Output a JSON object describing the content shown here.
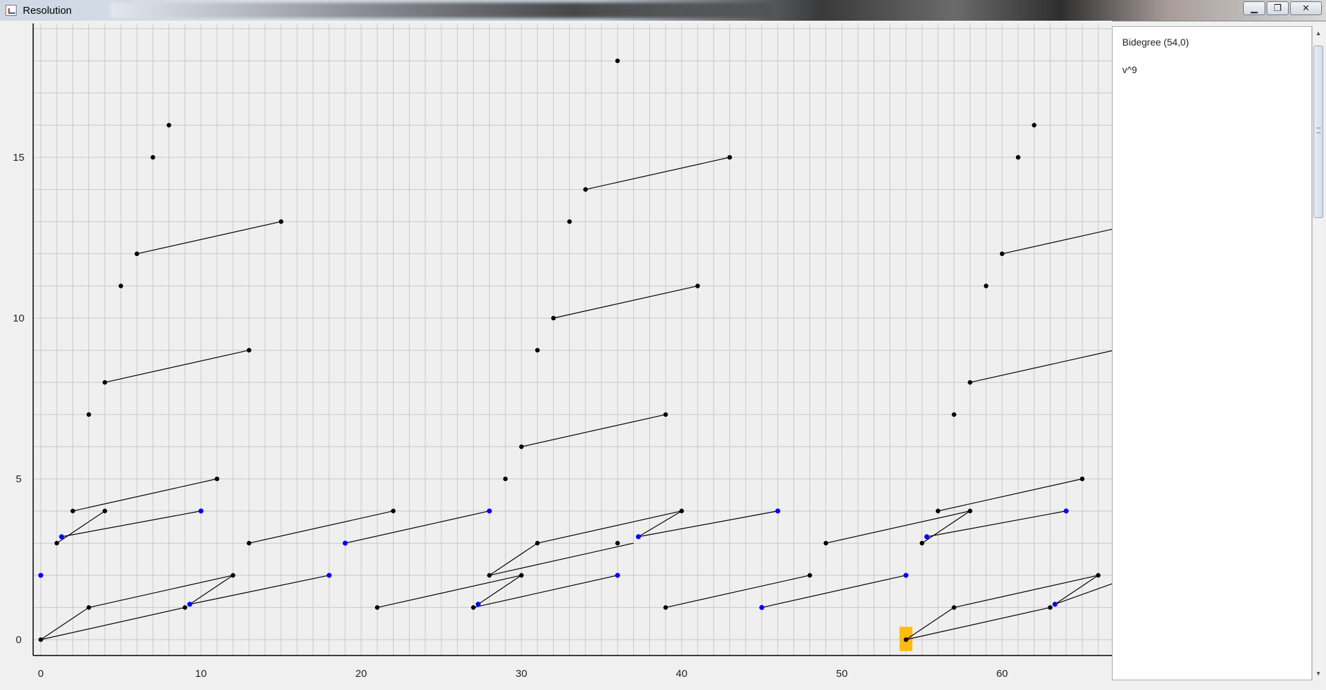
{
  "window": {
    "title": "Resolution",
    "minimize": "▁",
    "maximize": "❐",
    "close": "✕"
  },
  "info": {
    "line1": "Bidegree (54,0)",
    "line2": "v^9"
  },
  "colors": {
    "background": "#efefef",
    "grid": "#c8c8c8",
    "point": "#000000",
    "marked": "#0000ff",
    "highlight": "#ffbb11"
  },
  "chart_data": {
    "type": "scatter",
    "title": "",
    "xlabel": "",
    "ylabel": "",
    "xlim": [
      -0.5,
      66.5
    ],
    "ylim": [
      -0.3,
      19.3
    ],
    "grid": true,
    "x_ticks": [
      0,
      10,
      20,
      30,
      40,
      50,
      60
    ],
    "y_ticks": [
      0,
      5,
      10,
      15
    ],
    "highlight": {
      "x": 54,
      "y": 0
    },
    "points": [
      [
        0,
        0
      ],
      [
        3,
        1
      ],
      [
        9,
        1
      ],
      [
        12,
        2
      ],
      [
        1,
        3
      ],
      [
        2,
        4
      ],
      [
        4,
        4
      ],
      [
        11,
        5
      ],
      [
        3,
        7
      ],
      [
        4,
        8
      ],
      [
        13,
        9
      ],
      [
        5,
        11
      ],
      [
        6,
        12
      ],
      [
        15,
        13
      ],
      [
        7,
        15
      ],
      [
        8,
        16
      ],
      [
        21,
        1
      ],
      [
        13,
        3
      ],
      [
        22,
        4
      ],
      [
        27,
        1
      ],
      [
        30,
        2
      ],
      [
        28,
        2
      ],
      [
        31,
        3
      ],
      [
        36,
        3
      ],
      [
        40,
        4
      ],
      [
        29,
        5
      ],
      [
        30,
        6
      ],
      [
        39,
        7
      ],
      [
        31,
        9
      ],
      [
        32,
        10
      ],
      [
        41,
        11
      ],
      [
        33,
        13
      ],
      [
        34,
        14
      ],
      [
        43,
        15
      ],
      [
        36,
        18
      ],
      [
        39,
        1
      ],
      [
        48,
        2
      ],
      [
        49,
        3
      ],
      [
        54,
        0
      ],
      [
        57,
        1
      ],
      [
        63,
        1
      ],
      [
        66,
        2
      ],
      [
        55,
        3
      ],
      [
        56,
        4
      ],
      [
        58,
        4
      ],
      [
        65,
        5
      ],
      [
        57,
        7
      ],
      [
        58,
        8
      ],
      [
        59,
        11
      ],
      [
        60,
        12
      ],
      [
        61,
        15
      ],
      [
        62,
        16
      ]
    ],
    "marked_points": [
      [
        0,
        2
      ],
      [
        1.3,
        3.2
      ],
      [
        9.3,
        1.1
      ],
      [
        18,
        2
      ],
      [
        10,
        4
      ],
      [
        19,
        3
      ],
      [
        28,
        4
      ],
      [
        27.3,
        1.1
      ],
      [
        36,
        2
      ],
      [
        37.3,
        3.2
      ],
      [
        46,
        4
      ],
      [
        45,
        1
      ],
      [
        54,
        2
      ],
      [
        55.3,
        3.2
      ],
      [
        63.3,
        1.1
      ],
      [
        64,
        4
      ]
    ],
    "lines": [
      [
        [
          0,
          0
        ],
        [
          3,
          1
        ]
      ],
      [
        [
          0,
          0
        ],
        [
          9,
          1
        ]
      ],
      [
        [
          3,
          1
        ],
        [
          12,
          2
        ]
      ],
      [
        [
          9.3,
          1.1
        ],
        [
          12,
          2
        ]
      ],
      [
        [
          9.3,
          1.1
        ],
        [
          18,
          2
        ]
      ],
      [
        [
          1,
          3
        ],
        [
          4,
          4
        ]
      ],
      [
        [
          1.3,
          3.2
        ],
        [
          10,
          4
        ]
      ],
      [
        [
          2,
          4
        ],
        [
          11,
          5
        ]
      ],
      [
        [
          4,
          8
        ],
        [
          13,
          9
        ]
      ],
      [
        [
          6,
          12
        ],
        [
          15,
          13
        ]
      ],
      [
        [
          13,
          3
        ],
        [
          22,
          4
        ]
      ],
      [
        [
          19,
          3
        ],
        [
          28,
          4
        ]
      ],
      [
        [
          21,
          1
        ],
        [
          30,
          2
        ]
      ],
      [
        [
          27,
          1
        ],
        [
          36,
          2
        ]
      ],
      [
        [
          27.3,
          1.1
        ],
        [
          30,
          2
        ]
      ],
      [
        [
          28,
          2
        ],
        [
          31,
          3
        ]
      ],
      [
        [
          28,
          2
        ],
        [
          37,
          3
        ]
      ],
      [
        [
          31,
          3
        ],
        [
          40,
          4
        ]
      ],
      [
        [
          37.3,
          3.2
        ],
        [
          40,
          4
        ]
      ],
      [
        [
          37.3,
          3.2
        ],
        [
          46,
          4
        ]
      ],
      [
        [
          30,
          6
        ],
        [
          39,
          7
        ]
      ],
      [
        [
          32,
          10
        ],
        [
          41,
          11
        ]
      ],
      [
        [
          34,
          14
        ],
        [
          43,
          15
        ]
      ],
      [
        [
          39,
          1
        ],
        [
          48,
          2
        ]
      ],
      [
        [
          45,
          1
        ],
        [
          54,
          2
        ]
      ],
      [
        [
          49,
          3
        ],
        [
          58,
          4
        ]
      ],
      [
        [
          54,
          0
        ],
        [
          57,
          1
        ]
      ],
      [
        [
          54,
          0
        ],
        [
          63,
          1
        ]
      ],
      [
        [
          57,
          1
        ],
        [
          66,
          2
        ]
      ],
      [
        [
          63.3,
          1.1
        ],
        [
          66,
          2
        ]
      ],
      [
        [
          63.3,
          1.1
        ],
        [
          70,
          2.3
        ]
      ],
      [
        [
          55,
          3
        ],
        [
          58,
          4
        ]
      ],
      [
        [
          55.3,
          3.2
        ],
        [
          64,
          4
        ]
      ],
      [
        [
          56,
          4
        ],
        [
          65,
          5
        ]
      ],
      [
        [
          58,
          8
        ],
        [
          67,
          9
        ]
      ],
      [
        [
          60,
          12
        ],
        [
          69,
          13
        ]
      ]
    ]
  }
}
